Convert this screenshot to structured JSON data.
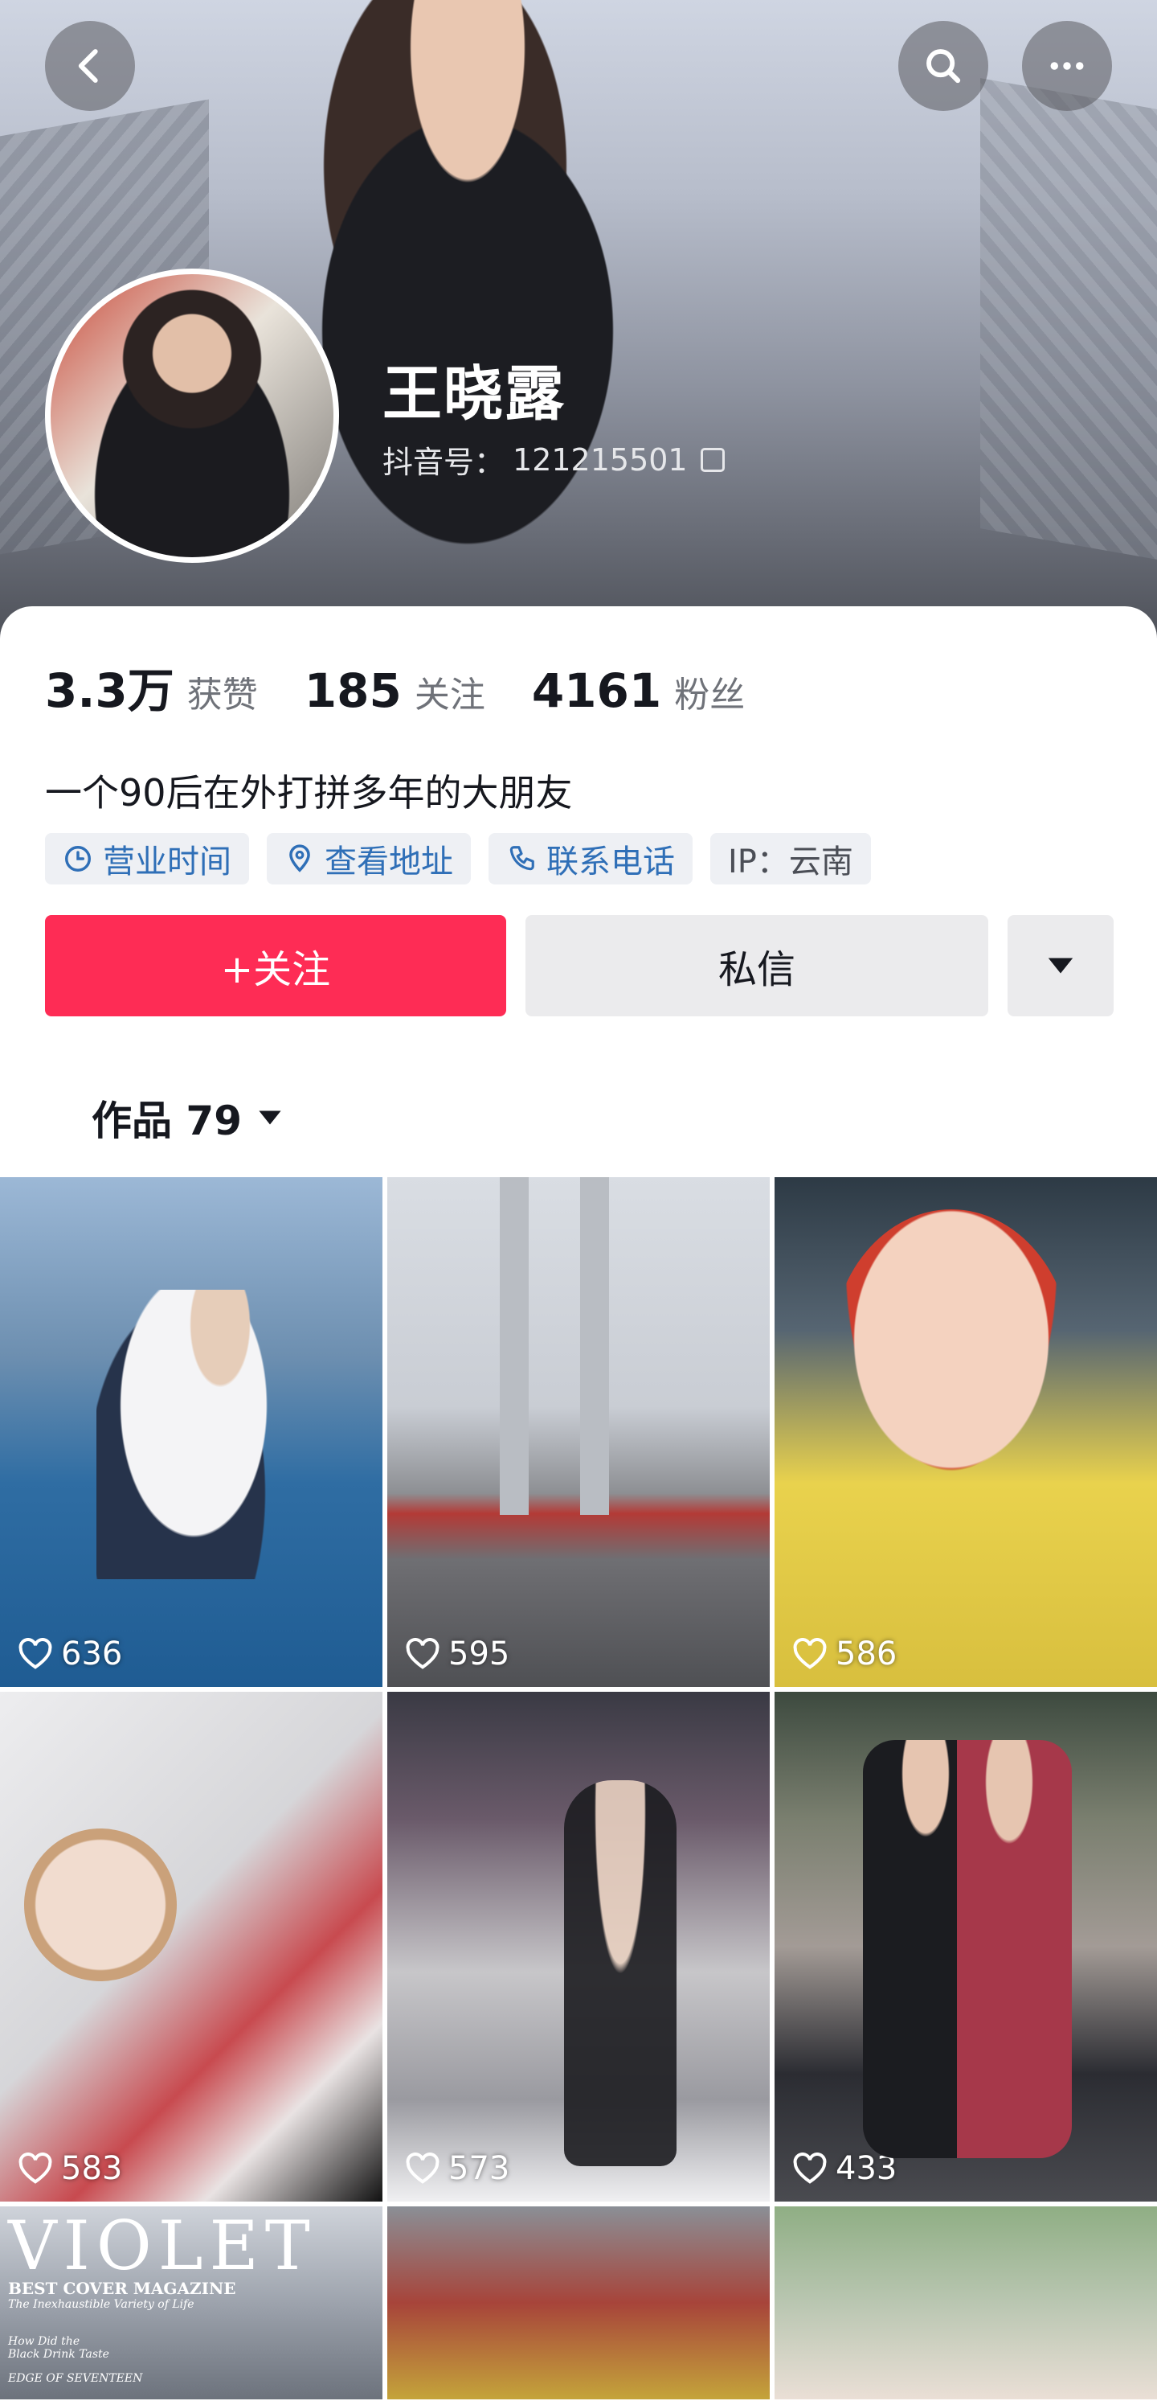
{
  "header": {
    "name": "王晓露",
    "uid_label": "抖音号：",
    "uid_value": "121215501"
  },
  "stats": [
    {
      "value": "3.3万",
      "label": "获赞"
    },
    {
      "value": "185",
      "label": "关注"
    },
    {
      "value": "4161",
      "label": "粉丝"
    }
  ],
  "bio": "一个90后在外打拼多年的大朋友",
  "tags": {
    "hours": "营业时间",
    "address": "查看地址",
    "phone": "联系电话",
    "ip": "IP：云南"
  },
  "actions": {
    "follow": "+关注",
    "message": "私信"
  },
  "tab": {
    "label": "作品",
    "count": "79"
  },
  "videos": [
    {
      "likes": "636"
    },
    {
      "likes": "595"
    },
    {
      "likes": "586"
    },
    {
      "likes": "583"
    },
    {
      "likes": "573"
    },
    {
      "likes": "433"
    }
  ],
  "partial_tile": {
    "title": "VIOLET",
    "line1": "BEST COVER MAGAZINE",
    "line2": "The Inexhaustible Variety of Life",
    "line3": "How Did the",
    "line4": "Black Drink Taste",
    "line5": "EDGE OF SEVENTEEN"
  },
  "colors": {
    "accent": "#fe2c55",
    "tag_text": "#2f6fb7"
  },
  "icons": [
    "back-icon",
    "search-icon",
    "more-icon",
    "copy-icon",
    "clock-icon",
    "location-icon",
    "phone-icon",
    "caret-down-icon",
    "heart-icon"
  ]
}
